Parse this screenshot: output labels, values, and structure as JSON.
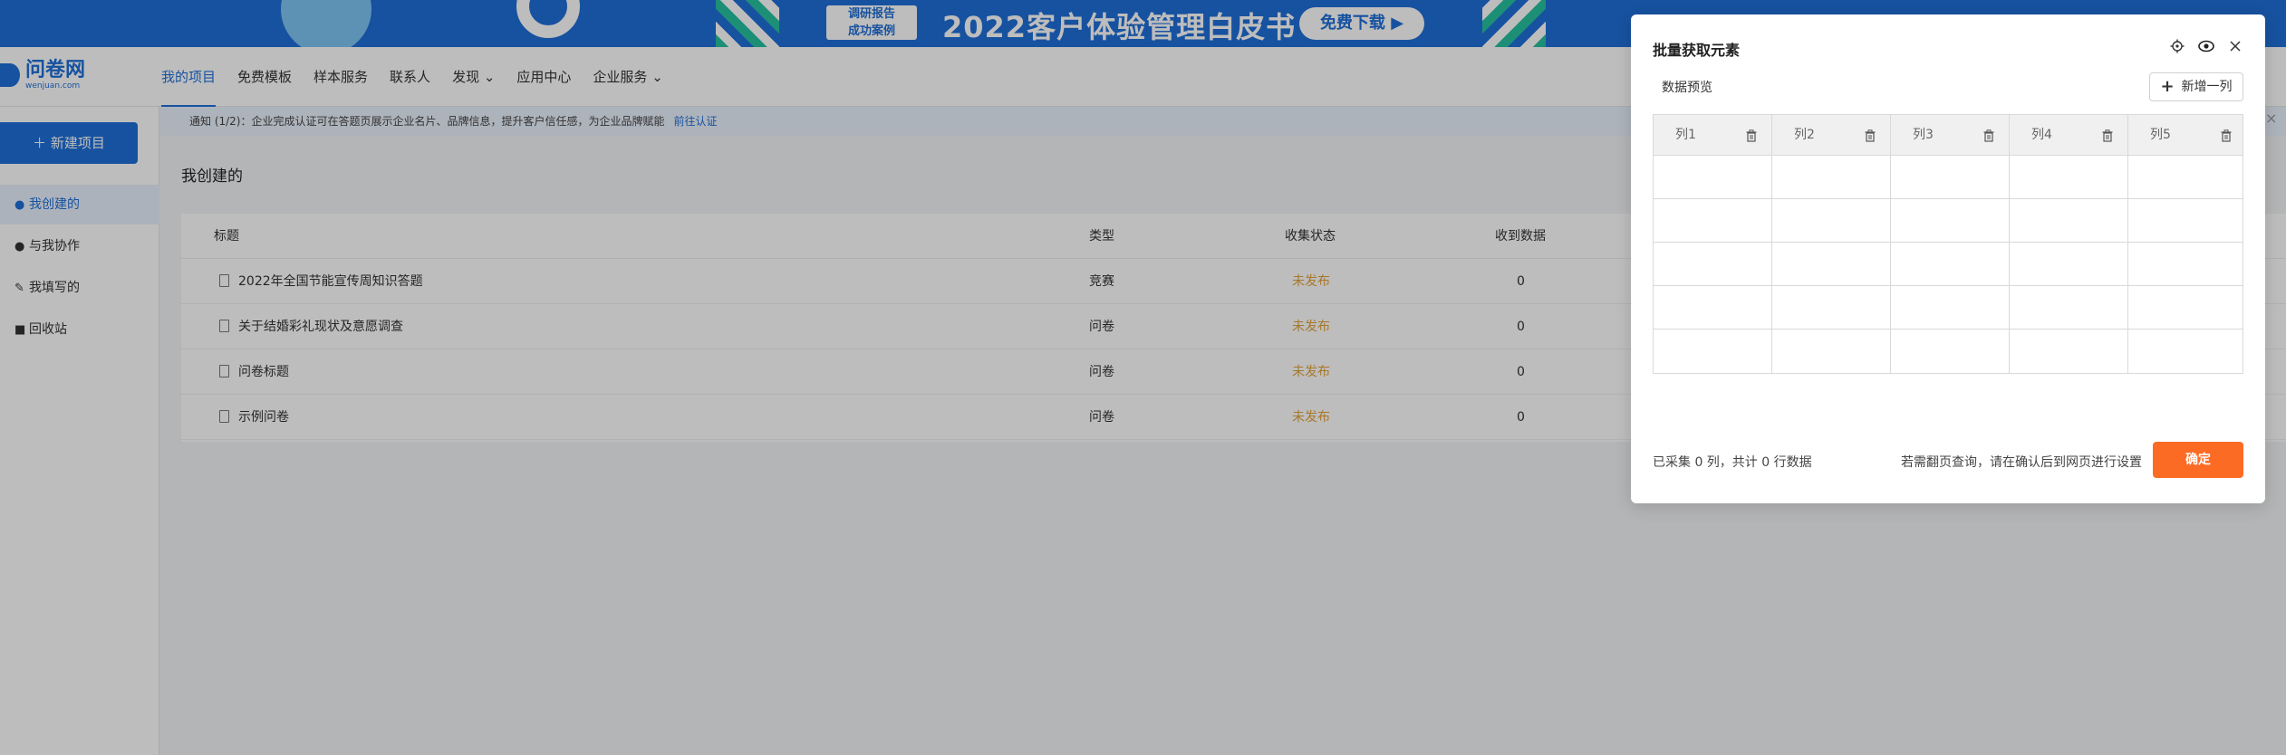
{
  "banner": {
    "tag_line1": "调研报告",
    "tag_line2": "成功案例",
    "title": "2022客户体验管理白皮书",
    "button": "免费下载 ▶",
    "colors": {
      "background": "#1f6fd8",
      "accent": "#27c2a0"
    }
  },
  "logo": {
    "name": "问卷网",
    "domain": "wenjuan.com"
  },
  "nav": {
    "items": [
      {
        "label": "我的项目"
      },
      {
        "label": "免费模板"
      },
      {
        "label": "样本服务"
      },
      {
        "label": "联系人"
      },
      {
        "label": "发现 ⌄"
      },
      {
        "label": "应用中心"
      },
      {
        "label": "企业服务 ⌄"
      }
    ]
  },
  "sidebar": {
    "new_button": "＋ 新建项目",
    "items": [
      {
        "label": "我创建的",
        "icon": "user-icon"
      },
      {
        "label": "与我协作",
        "icon": "team-icon"
      },
      {
        "label": "我填写的",
        "icon": "edit-icon"
      },
      {
        "label": "回收站",
        "icon": "trash-icon"
      }
    ]
  },
  "notice": {
    "text": "通知   (1/2)：企业完成认证可在答题页展示企业名片、品牌信息，提升客户信任感，为企业品牌赋能",
    "link": "前往认证",
    "close": "×"
  },
  "main": {
    "section_title": "我创建的",
    "table": {
      "headers": [
        "标题",
        "类型",
        "收集状态",
        "收到数据"
      ],
      "rows": [
        {
          "title": "2022年全国节能宣传周知识答题",
          "type": "竞赛",
          "status": "未发布",
          "count": "0"
        },
        {
          "title": "关于结婚彩礼现状及意愿调查",
          "type": "问卷",
          "status": "未发布",
          "count": "0"
        },
        {
          "title": "问卷标题",
          "type": "问卷",
          "status": "未发布",
          "count": "0"
        },
        {
          "title": "示例问卷",
          "type": "问卷",
          "status": "未发布",
          "count": "0"
        }
      ]
    }
  },
  "modal": {
    "title": "批量获取元素",
    "icons": [
      "target-icon",
      "eye-icon",
      "close-icon"
    ],
    "preview_label": "数据预览",
    "add_column": "新增一列",
    "columns": [
      "列1",
      "列2",
      "列3",
      "列4",
      "列5"
    ],
    "summary": "已采集 0 列，共计 0 行数据",
    "hint": "若需翻页查询，请在确认后到网页进行设置",
    "confirm": "确定",
    "colors": {
      "confirm": "#fc6b24"
    }
  }
}
